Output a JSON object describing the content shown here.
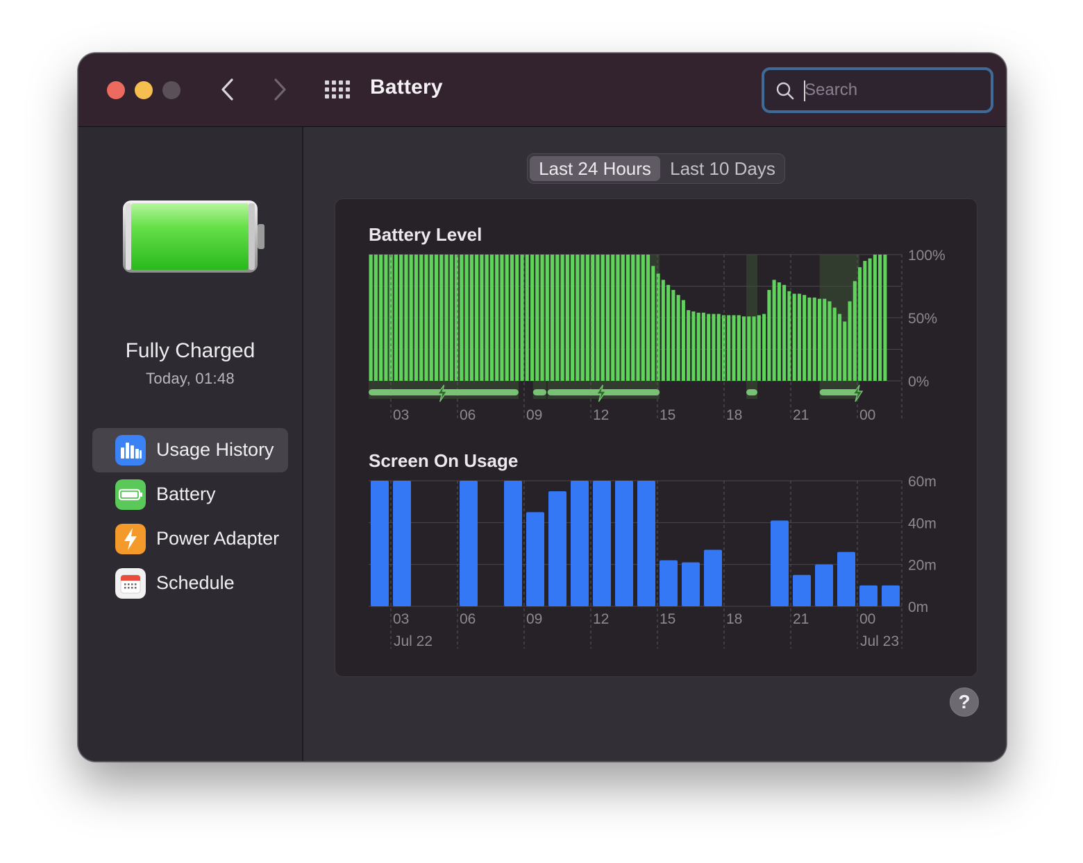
{
  "window": {
    "title": "Battery",
    "search": {
      "placeholder": "Search",
      "value": ""
    }
  },
  "sidebar": {
    "status": {
      "title": "Fully Charged",
      "subtitle": "Today, 01:48"
    },
    "items": [
      {
        "label": "Usage History",
        "icon": "bar-chart-icon",
        "icon_color": "#3b82f6",
        "selected": true
      },
      {
        "label": "Battery",
        "icon": "battery-icon",
        "icon_color": "#5ac95a",
        "selected": false
      },
      {
        "label": "Power Adapter",
        "icon": "bolt-icon",
        "icon_color": "#f39a2b",
        "selected": false
      },
      {
        "label": "Schedule",
        "icon": "calendar-icon",
        "icon_color": "#f2f2f2",
        "selected": false
      }
    ]
  },
  "segmented": {
    "options": [
      "Last 24 Hours",
      "Last 10 Days"
    ],
    "selected": 0
  },
  "help_label": "?",
  "colors": {
    "battery_bar": "#5fd35b",
    "screen_bar": "#3478f6",
    "charging": "#78c274"
  },
  "chart_data": [
    {
      "type": "bar",
      "title": "Battery Level",
      "yticks": [
        "100%",
        "50%",
        "0%"
      ],
      "ylim": [
        0,
        100
      ],
      "xticks": [
        "03",
        "06",
        "09",
        "12",
        "15",
        "18",
        "21",
        "00"
      ],
      "x_start_hour": 2,
      "x_end_hour": 26,
      "charging_segments": [
        {
          "start": 2.0,
          "end": 8.75
        },
        {
          "start": 9.4,
          "end": 10.0
        },
        {
          "start": 10.05,
          "end": 15.1
        },
        {
          "start": 19.0,
          "end": 19.5
        },
        {
          "start": 22.3,
          "end": 24.1
        }
      ],
      "charging_icons_at": [
        5.3,
        12.45,
        24.0
      ],
      "values": [
        100,
        100,
        100,
        100,
        100,
        100,
        100,
        100,
        100,
        100,
        100,
        100,
        100,
        100,
        100,
        100,
        100,
        100,
        100,
        100,
        100,
        100,
        100,
        100,
        100,
        100,
        100,
        100,
        100,
        100,
        100,
        100,
        100,
        100,
        100,
        100,
        100,
        100,
        100,
        100,
        100,
        100,
        100,
        100,
        100,
        100,
        100,
        100,
        100,
        100,
        100,
        100,
        100,
        100,
        100,
        100,
        91,
        85,
        80,
        76,
        72,
        68,
        64,
        56,
        55,
        54,
        54,
        53,
        53,
        53,
        52,
        52,
        52,
        52,
        51,
        51,
        51,
        52,
        53,
        72,
        80,
        78,
        76,
        71,
        69,
        69,
        68,
        66,
        66,
        65,
        65,
        63,
        58,
        53,
        47,
        63,
        79,
        90,
        95,
        97,
        100,
        100,
        100
      ]
    },
    {
      "type": "bar",
      "title": "Screen On Usage",
      "yticks": [
        "60m",
        "40m",
        "20m",
        "0m"
      ],
      "ylim": [
        0,
        60
      ],
      "xticks": [
        "03",
        "06",
        "09",
        "12",
        "15",
        "18",
        "21",
        "00"
      ],
      "date_labels": [
        {
          "hour": 3,
          "label": "Jul 22"
        },
        {
          "hour": 24,
          "label": "Jul 23"
        }
      ],
      "x_start_hour": 2,
      "x_end_hour": 26,
      "values": [
        60,
        60,
        0,
        0,
        60,
        0,
        60,
        45,
        55,
        60,
        60,
        60,
        60,
        22,
        21,
        27,
        0,
        0,
        41,
        15,
        20,
        26,
        10,
        10
      ]
    }
  ]
}
